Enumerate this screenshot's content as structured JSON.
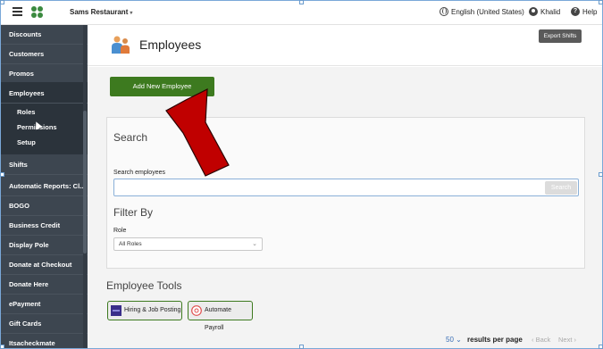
{
  "topbar": {
    "restaurant": "Sams Restaurant",
    "language": "English (United States)",
    "user": "Khalid",
    "help": "Help"
  },
  "sidebar": {
    "items": [
      {
        "label": "Discounts"
      },
      {
        "label": "Customers"
      },
      {
        "label": "Promos"
      },
      {
        "label": "Employees"
      },
      {
        "label": "Shifts"
      },
      {
        "label": "Automatic Reports: Cl..."
      },
      {
        "label": "BOGO"
      },
      {
        "label": "Business Credit"
      },
      {
        "label": "Display Pole"
      },
      {
        "label": "Donate at Checkout"
      },
      {
        "label": "Donate Here"
      },
      {
        "label": "ePayment"
      },
      {
        "label": "Gift Cards"
      },
      {
        "label": "Itsacheckmate"
      }
    ],
    "subitems": [
      {
        "label": "Roles"
      },
      {
        "label": "Permissions"
      },
      {
        "label": "Setup"
      }
    ]
  },
  "header": {
    "title": "Employees",
    "export_label": "Export Shifts"
  },
  "main": {
    "add_label": "Add New Employee",
    "search_title": "Search",
    "search_label": "Search employees",
    "search_value": "",
    "search_button": "Search",
    "filter_title": "Filter By",
    "role_label": "Role",
    "role_value": "All Roles",
    "tools_title": "Employee Tools",
    "tools": [
      {
        "label": "Hiring & Job Posting"
      },
      {
        "label": "Automate Payroll"
      }
    ]
  },
  "pager": {
    "page_size": "50",
    "size_label": "results per page",
    "back": "Back",
    "next": "Next"
  },
  "colors": {
    "sidebar": "#3d4650",
    "primary_button": "#3d7a1f",
    "annotation_arrow": "#c00000"
  }
}
